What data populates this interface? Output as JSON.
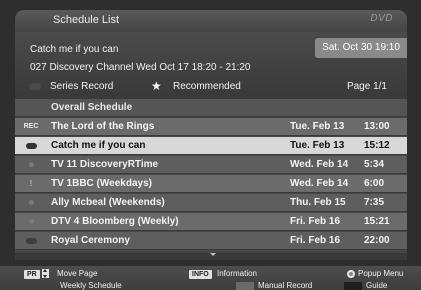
{
  "window": {
    "title": "Schedule List",
    "logo": "DVD"
  },
  "info": {
    "program_title": "Catch me if you can",
    "program_detail": "027 Discovery Channel Wed Oct 17    18:20 - 21:20",
    "clock": "Sat. Oct 30   19:10"
  },
  "legend": {
    "series_label": "Series Record",
    "recommended_label": "Recommended",
    "page": "Page 1/1"
  },
  "list": {
    "header": "Overall Schedule",
    "rows": [
      {
        "icon": "REC",
        "name": "The Lord of the Rings",
        "date": "Tue. Feb 13",
        "time": "13:00"
      },
      {
        "icon": "",
        "name": "Catch me if you can",
        "date": "Tue. Feb 13",
        "time": "15:12"
      },
      {
        "icon": "",
        "name": "TV  11 DiscoveryRTime",
        "date": "Wed. Feb 14",
        "time": "5:34"
      },
      {
        "icon": "!",
        "name": "TV  1BBC (Weekdays)",
        "date": "Wed. Feb 14",
        "time": "6:00"
      },
      {
        "icon": "",
        "name": "Ally Mcbeal (Weekends)",
        "date": "Thu. Feb 15",
        "time": "7:35"
      },
      {
        "icon": "",
        "name": "DTV 4 Bloomberg (Weekly)",
        "date": "Fri. Feb 16",
        "time": "15:21"
      },
      {
        "icon": "",
        "name": "Royal Ceremony",
        "date": "Fri. Feb 16",
        "time": "22:00"
      }
    ]
  },
  "footer": {
    "pr_badge": "PR",
    "move_page": "Move Page",
    "info_badge": "INFO",
    "information": "Information",
    "popup_menu": "Popup Menu",
    "weekly_schedule": "Weekly Schedule",
    "manual_record": "Manual Record",
    "guide": "Guide"
  },
  "colors": {
    "selected_row": "#d8d8d8",
    "row": "#6b6b6b",
    "clock_bg": "#8a8a8a"
  },
  "icons": [
    "rec-badge-icon",
    "record-pill-icon",
    "star-icon",
    "up-down-icon",
    "popup-menu-icon",
    "scroll-down-icon"
  ]
}
